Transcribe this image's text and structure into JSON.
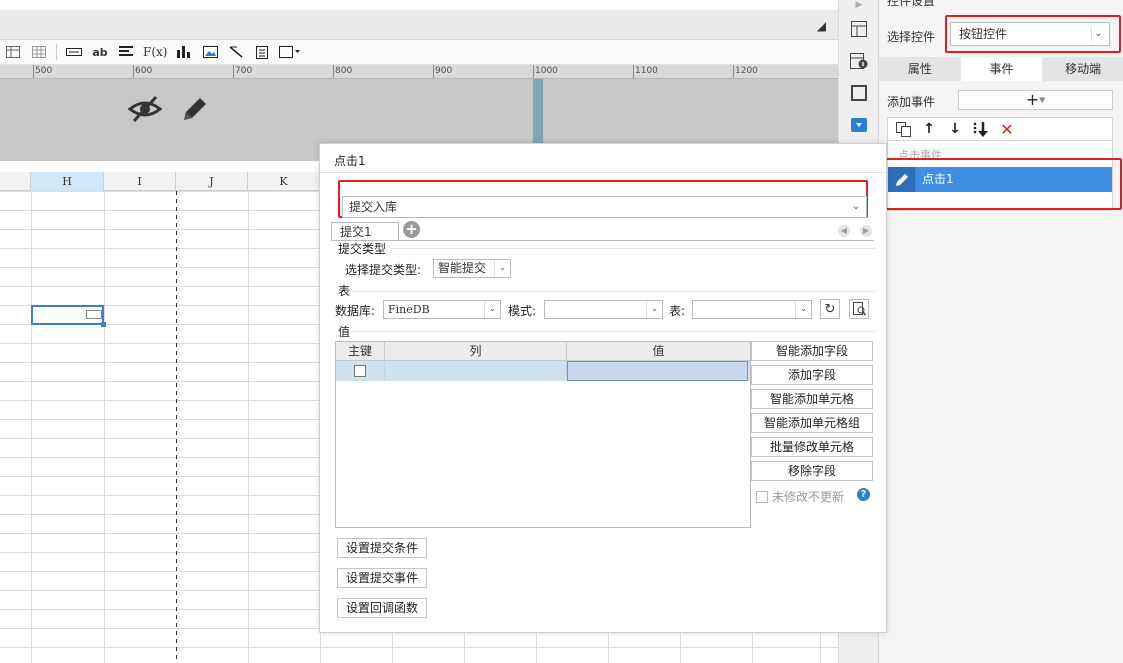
{
  "ruler": {
    "labels": [
      "500",
      "600",
      "700",
      "800",
      "900",
      "1000",
      "1100",
      "1200"
    ]
  },
  "grid": {
    "columns": [
      "H",
      "I",
      "J",
      "K"
    ]
  },
  "panel": {
    "title": "控件设置",
    "select_label": "选择控件",
    "select_value": "按钮控件",
    "tabs": [
      "属性",
      "事件",
      "移动端"
    ],
    "add_event_label": "添加事件",
    "add_event_symbol": "+",
    "event_group": "点击事件",
    "event_item": "点击1"
  },
  "dialog": {
    "title": "点击1",
    "action_value": "提交入库",
    "tab_label": "提交1",
    "submit_type_section": "提交类型",
    "submit_type_label": "选择提交类型:",
    "submit_type_value": "智能提交",
    "table_section": "表",
    "db_label": "数据库:",
    "db_value": "FineDB",
    "mode_label": "模式:",
    "mode_value": "",
    "table_label": "表:",
    "table_value": "",
    "value_section": "值",
    "value_table": {
      "headers": [
        "主键",
        "列",
        "值"
      ]
    },
    "side_buttons": [
      "智能添加字段",
      "添加字段",
      "智能添加单元格",
      "智能添加单元格组",
      "批量修改单元格",
      "移除字段"
    ],
    "no_update_label": "未修改不更新",
    "help_symbol": "?",
    "bottom_buttons": [
      "设置提交条件",
      "设置提交事件",
      "设置回调函数"
    ]
  },
  "colors": {
    "highlight_red": "#e02020",
    "selection_blue": "#3e8ee4",
    "teal_marker": "#7fa8b4"
  }
}
